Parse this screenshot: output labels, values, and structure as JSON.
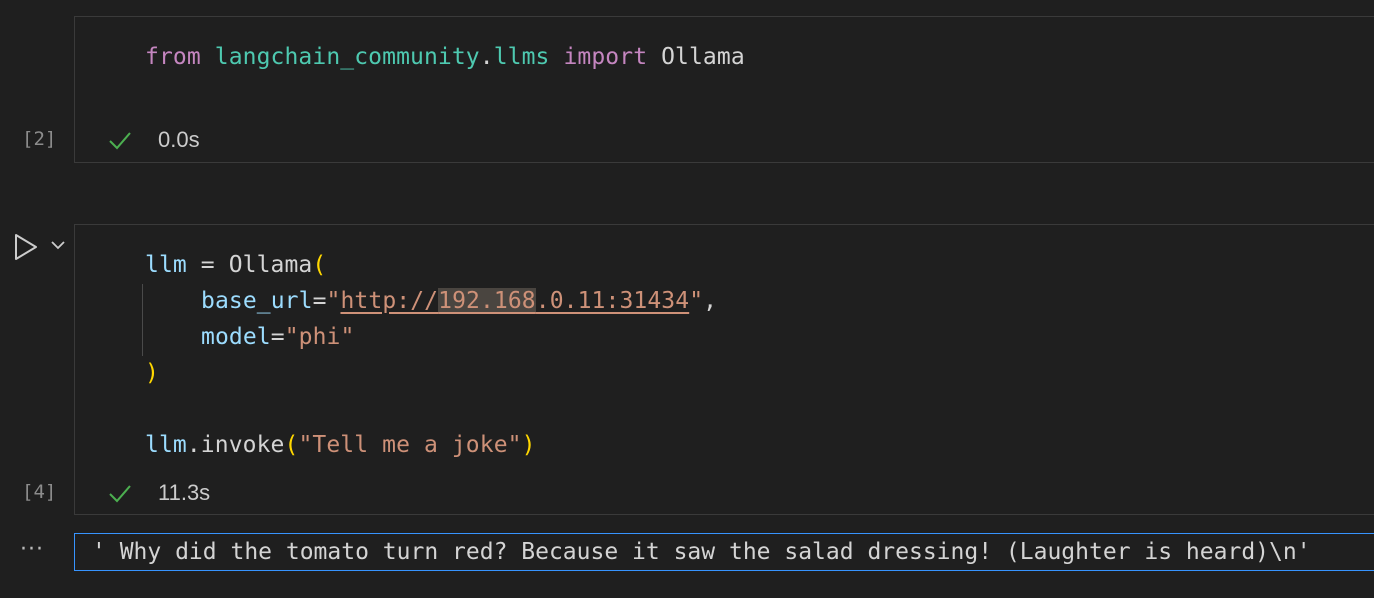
{
  "cell1": {
    "code_from": "from",
    "code_module": "langchain_community",
    "code_dot": ".",
    "code_submodule": "llms",
    "code_import": "import",
    "code_name": "Ollama",
    "exec_count": "[2]",
    "duration": "0.0s",
    "status_icon": "check-icon"
  },
  "cell2": {
    "line1_var": "llm",
    "line1_eq": " = ",
    "line1_fn": "Ollama",
    "line1_paren": "(",
    "line2_param": "base_url",
    "line2_eq": "=",
    "line2_q1": "\"",
    "line2_url_a": "http://",
    "line2_url_hl": "192.168",
    "line2_url_b": ".0.11:31434",
    "line2_q2": "\"",
    "line2_comma": ",",
    "line3_param": "model",
    "line3_eq": "=",
    "line3_str": "\"phi\"",
    "line4_paren": ")",
    "line5_var": "llm",
    "line5_dot": ".",
    "line5_fn": "invoke",
    "line5_p1": "(",
    "line5_str": "\"Tell me a joke\"",
    "line5_p2": ")",
    "exec_count": "[4]",
    "duration": "11.3s",
    "status_icon": "check-icon"
  },
  "output": {
    "text": "' Why did the tomato turn red? Because it saw the salad dressing! (Laughter is heard)\\n'",
    "more_label": "···"
  },
  "colors": {
    "background": "#1f1f1f",
    "keyword": "#c586c0",
    "module": "#4ec9b0",
    "variable": "#9cdcfe",
    "string": "#ce9178",
    "bracket": "#ffd700",
    "success": "#4caf50",
    "focus_border": "#3794ff"
  }
}
